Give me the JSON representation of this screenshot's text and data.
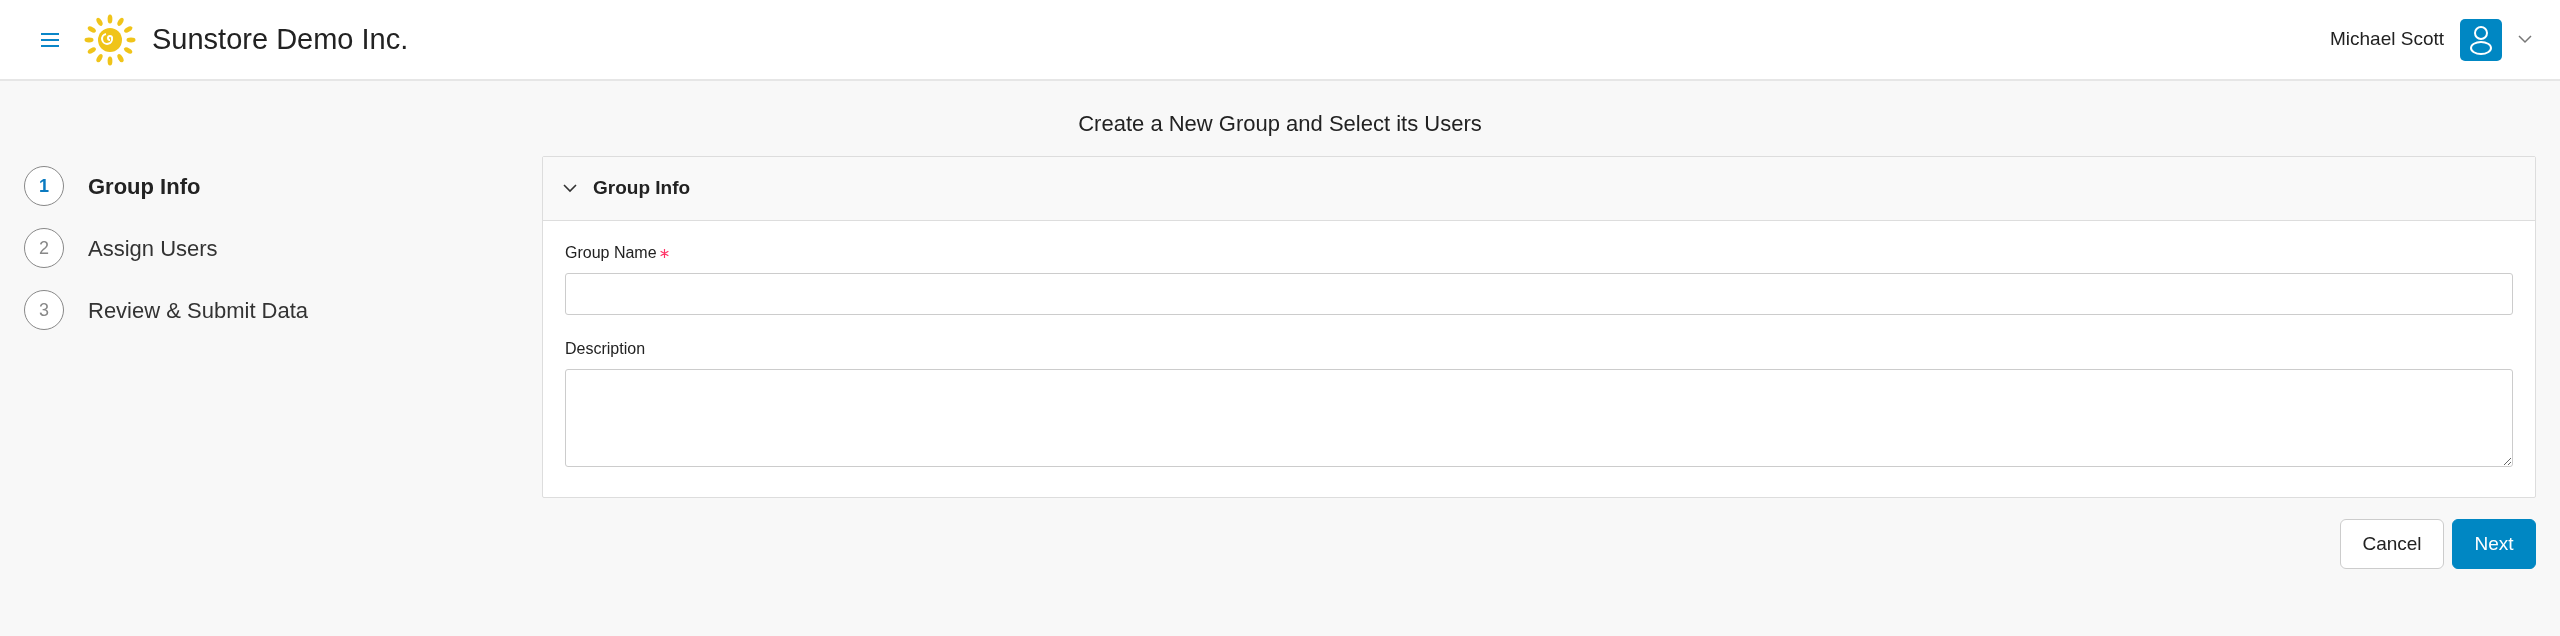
{
  "header": {
    "brand": "Sunstore Demo Inc.",
    "user_name": "Michael Scott"
  },
  "page_title": "Create a New Group and Select its Users",
  "steps": [
    {
      "number": "1",
      "label": "Group Info",
      "selected": true
    },
    {
      "number": "2",
      "label": "Assign Users",
      "selected": false
    },
    {
      "number": "3",
      "label": "Review & Submit Data",
      "selected": false
    }
  ],
  "panel": {
    "title": "Group Info",
    "expanded": true,
    "fields": [
      {
        "kind": "input",
        "label": "Group Name",
        "required": true
      },
      {
        "kind": "textarea",
        "label": "Description",
        "required": false
      }
    ]
  },
  "buttons": [
    {
      "label": "Cancel",
      "kind": "secondary"
    },
    {
      "label": "Next",
      "kind": "primary"
    }
  ]
}
